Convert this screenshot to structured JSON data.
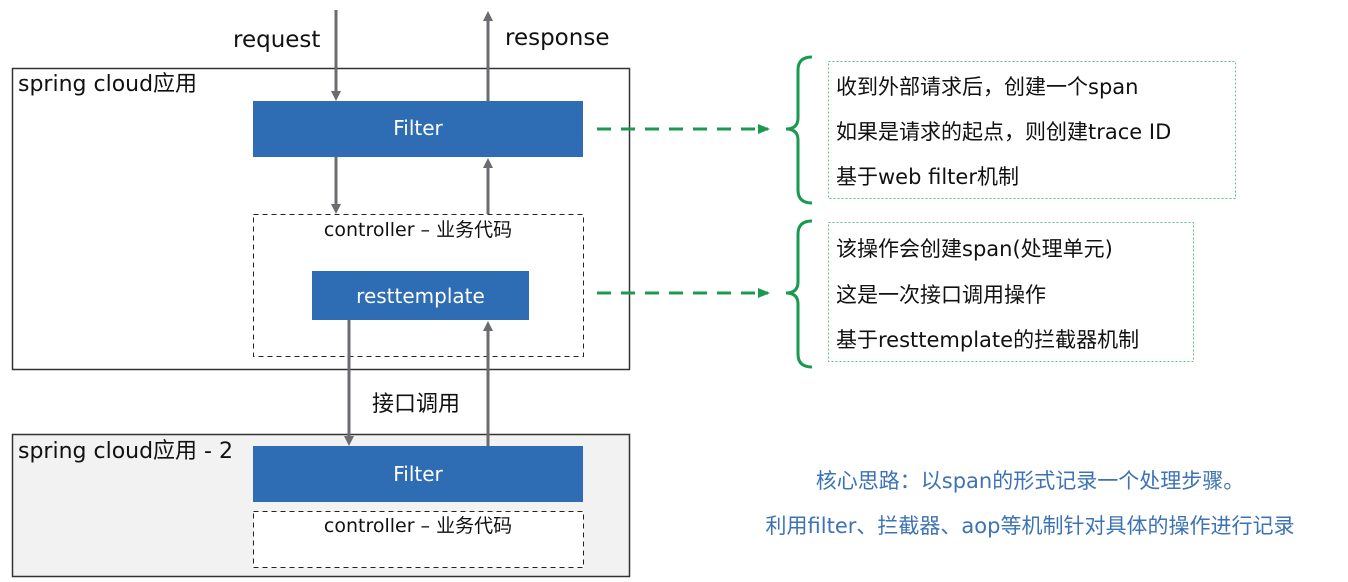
{
  "flow": {
    "request_label": "request",
    "response_label": "response",
    "interface_call_label": "接口调用"
  },
  "app1": {
    "title": "spring cloud应用",
    "filter_label": "Filter",
    "controller_label": "controller – 业务代码",
    "resttemplate_label": "resttemplate"
  },
  "app2": {
    "title": "spring cloud应用 - 2",
    "filter_label": "Filter",
    "controller_label": "controller – 业务代码"
  },
  "notes": {
    "filter_notes": [
      "收到外部请求后，创建一个span",
      "如果是请求的起点，则创建trace ID",
      "基于web filter机制"
    ],
    "resttemplate_notes": [
      "该操作会创建span(处理单元)",
      "这是一次接口调用操作",
      "基于resttemplate的拦截器机制"
    ]
  },
  "summary": {
    "line1": "核心思路：以span的形式记录一个处理步骤。",
    "line2": "利用filter、拦截器、aop等机制针对具体的操作进行记录"
  },
  "colors": {
    "box_blue": "#2e6db4",
    "arrow_gray": "#6b6b70",
    "green": "#1a9a50",
    "summary_blue": "#3d73b5"
  }
}
